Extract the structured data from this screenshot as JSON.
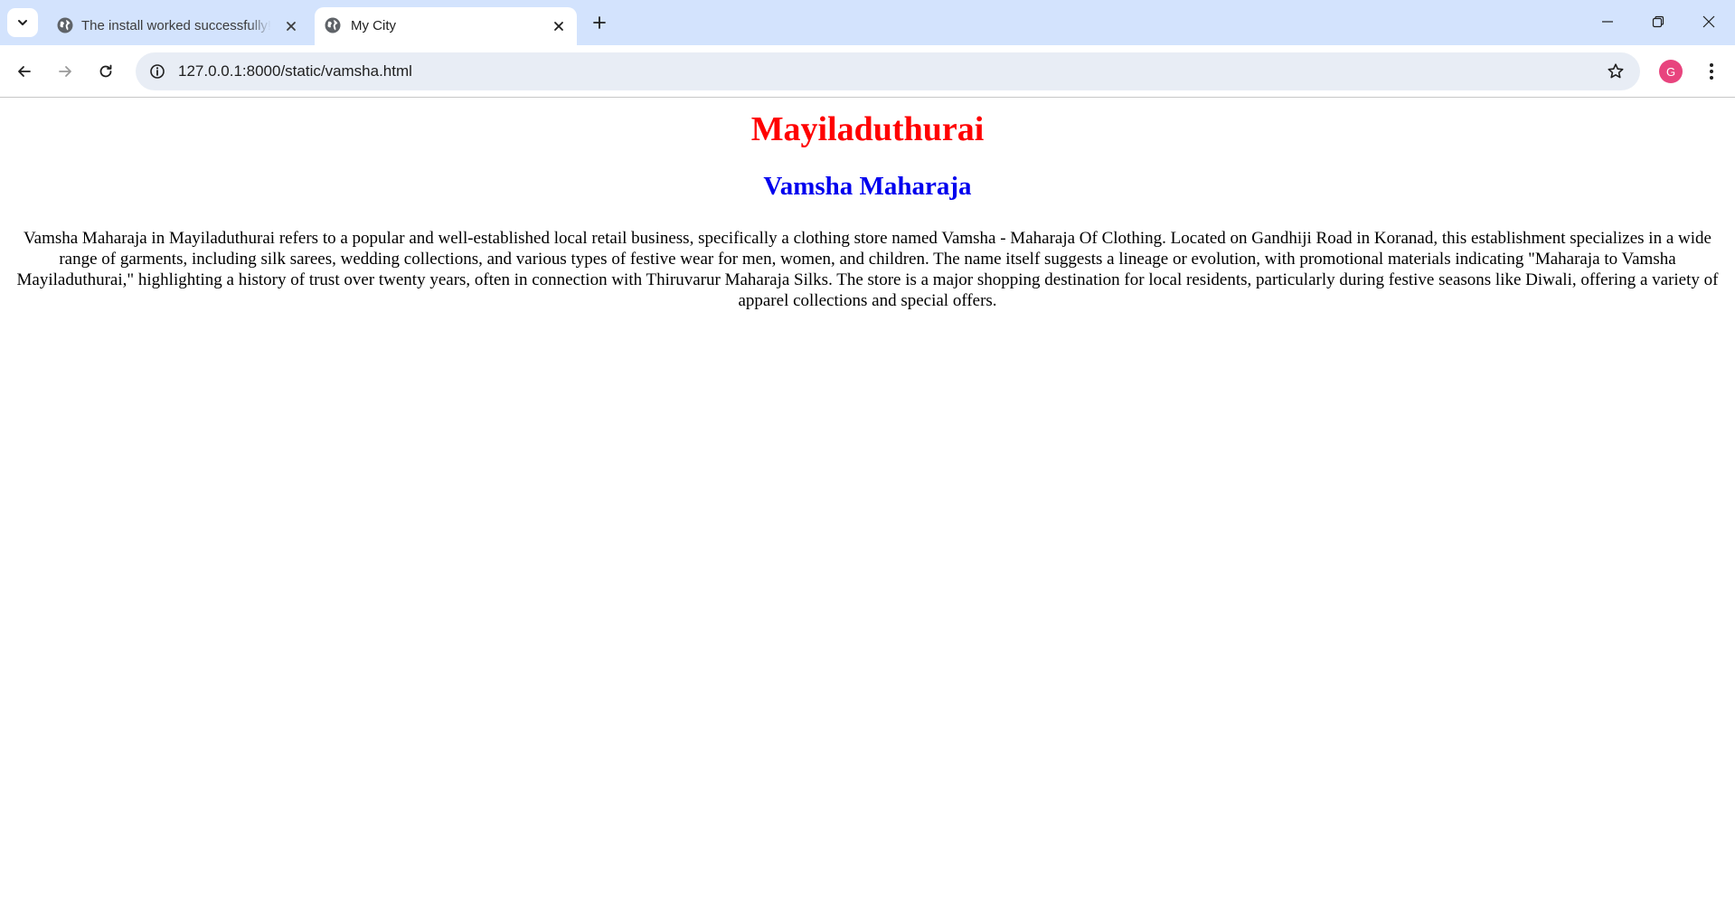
{
  "browser": {
    "tabs": [
      {
        "title": "The install worked successfully! Congratulations!",
        "active": false
      },
      {
        "title": "My City",
        "active": true
      }
    ],
    "address": {
      "url": "127.0.0.1:8000/static/vamsha.html"
    },
    "profile": {
      "initial": "G",
      "color": "#e8447e"
    },
    "icons": {
      "tab_search": "chevron-down-icon",
      "favicon": "globe-icon",
      "tab_close": "close-icon",
      "new_tab": "plus-icon",
      "back": "arrow-left-icon",
      "forward": "arrow-right-icon",
      "reload": "reload-icon",
      "site_info": "info-icon",
      "bookmark": "star-icon",
      "menu": "kebab-menu-icon",
      "minimize": "minimize-icon",
      "restore": "restore-icon",
      "close_window": "close-icon"
    }
  },
  "page": {
    "heading": "Mayiladuthurai",
    "heading_color": "#ff0000",
    "subheading": "Vamsha Maharaja",
    "subheading_color": "#0000ee",
    "body": "Vamsha Maharaja in Mayiladuthurai refers to a popular and well-established local retail business, specifically a clothing store named Vamsha - Maharaja Of Clothing. Located on Gandhiji Road in Koranad, this establishment specializes in a wide range of garments, including silk sarees, wedding collections, and various types of festive wear for men, women, and children. The name itself suggests a lineage or evolution, with promotional materials indicating \"Maharaja to Vamsha Mayiladuthurai,\" highlighting a history of trust over twenty years, often in connection with Thiruvarur Maharaja Silks. The store is a major shopping destination for local residents, particularly during festive seasons like Diwali, offering a variety of apparel collections and special offers."
  }
}
